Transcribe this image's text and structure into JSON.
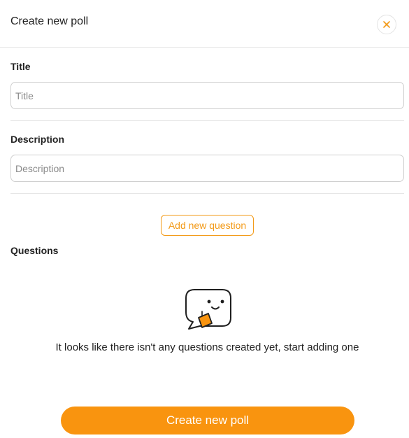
{
  "header": {
    "title": "Create new poll",
    "close_icon": "close-icon"
  },
  "form": {
    "title_label": "Title",
    "title_placeholder": "Title",
    "title_value": "",
    "description_label": "Description",
    "description_placeholder": "Description",
    "description_value": ""
  },
  "questions": {
    "add_button_label": "Add new question",
    "section_label": "Questions",
    "empty_icon": "speech-bubble-smiley-icon",
    "empty_message": "It looks like there isn't any questions created yet, start adding one"
  },
  "footer": {
    "submit_label": "Create new poll"
  },
  "colors": {
    "accent": "#f9940f",
    "accent_border": "#f39a17",
    "border": "#cfcfcf",
    "divider": "#e6e6e6"
  }
}
